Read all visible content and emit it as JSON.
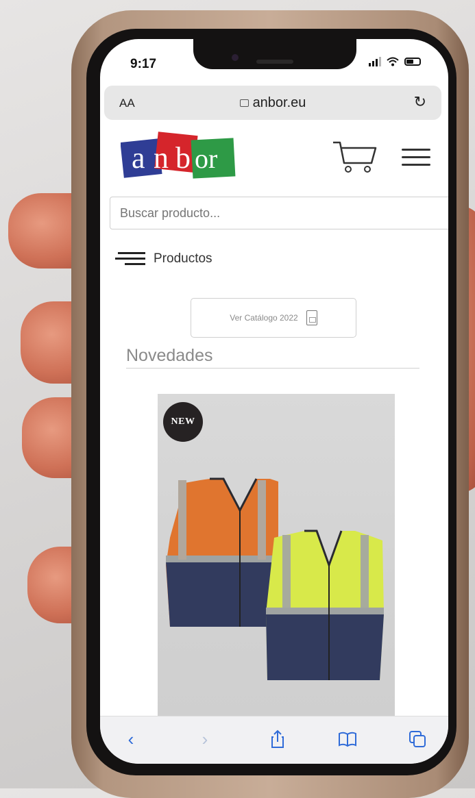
{
  "status_bar": {
    "time": "9:17"
  },
  "browser": {
    "text_size": "AA",
    "url": "anbor.eu",
    "reload_icon": "reload-icon"
  },
  "header": {
    "logo_letters": [
      "a",
      "n",
      "b",
      "or"
    ],
    "logo_colors": [
      "#2f3d95",
      "#d5252b",
      "#2e9a46"
    ],
    "cart_icon": "cart-icon",
    "menu_icon": "hamburger-icon"
  },
  "search": {
    "placeholder": "Buscar producto..."
  },
  "products_menu": {
    "label": "Productos"
  },
  "catalog": {
    "label": "Ver Catálogo 2022"
  },
  "section": {
    "title": "Novedades"
  },
  "product": {
    "badge": "NEW"
  },
  "toolbar": {
    "back_icon": "‹",
    "forward_icon": "›",
    "share_icon": "share-icon",
    "bookmarks_icon": "bookmarks-icon",
    "tabs_icon": "tabs-icon"
  }
}
